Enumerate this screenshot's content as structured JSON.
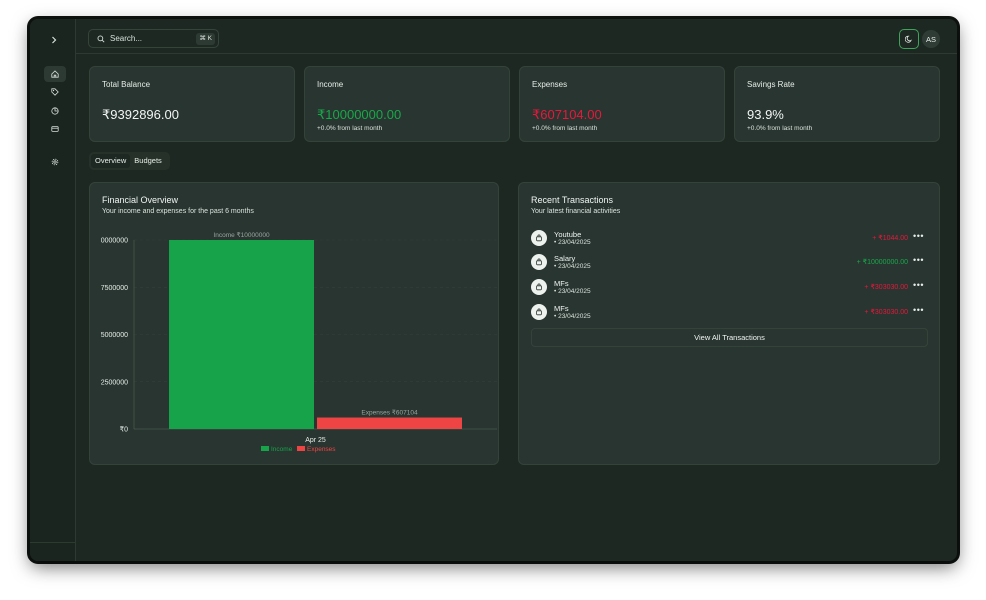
{
  "topbar": {
    "search_placeholder": "Search...",
    "search_shortcut": "⌘ K",
    "avatar_initials": "AS"
  },
  "sidebar": {
    "items": [
      {
        "icon": "home-icon"
      },
      {
        "icon": "tag-icon"
      },
      {
        "icon": "pie-chart-icon"
      },
      {
        "icon": "credit-card-icon"
      },
      {
        "icon": "gear-icon"
      }
    ]
  },
  "stats": [
    {
      "title": "Total Balance",
      "value": "₹9392896.00",
      "sub": ""
    },
    {
      "title": "Income",
      "value": "₹10000000.00",
      "sub": "+0.0% from last month"
    },
    {
      "title": "Expenses",
      "value": "₹607104.00",
      "sub": "+0.0% from last month"
    },
    {
      "title": "Savings Rate",
      "value": "93.9%",
      "sub": "+0.0% from last month"
    }
  ],
  "tabs": [
    {
      "label": "Overview"
    },
    {
      "label": "Budgets"
    }
  ],
  "overview": {
    "title": "Financial Overview",
    "subtitle": "Your income and expenses for the past 6 months"
  },
  "chart_data": {
    "type": "bar",
    "categories": [
      "Apr 25"
    ],
    "series": [
      {
        "name": "Income",
        "values": [
          10000000
        ],
        "color": "#16a34a",
        "label": "Income ₹10000000"
      },
      {
        "name": "Expenses",
        "values": [
          607104
        ],
        "color": "#ef4444",
        "label": "Expenses ₹607104"
      }
    ],
    "ylim": [
      0,
      10000000
    ],
    "yticks": [
      0,
      2500000,
      5000000,
      7500000,
      10000000
    ],
    "ytick_labels": [
      "₹0",
      "2500000",
      "5000000",
      "7500000",
      "0000000"
    ],
    "grid": true,
    "legend": "bottom"
  },
  "transactions": {
    "title": "Recent Transactions",
    "subtitle": "Your latest financial activities",
    "items": [
      {
        "name": "Youtube",
        "date": "• 23/04/2025",
        "amount": "+ ₹1044.00",
        "color": "red"
      },
      {
        "name": "Salary",
        "date": "• 23/04/2025",
        "amount": "+ ₹10000000.00",
        "color": "green"
      },
      {
        "name": "MFs",
        "date": "• 23/04/2025",
        "amount": "+ ₹303030.00",
        "color": "red"
      },
      {
        "name": "MFs",
        "date": "• 23/04/2025",
        "amount": "+ ₹303030.00",
        "color": "red"
      }
    ],
    "view_all_label": "View All Transactions"
  }
}
